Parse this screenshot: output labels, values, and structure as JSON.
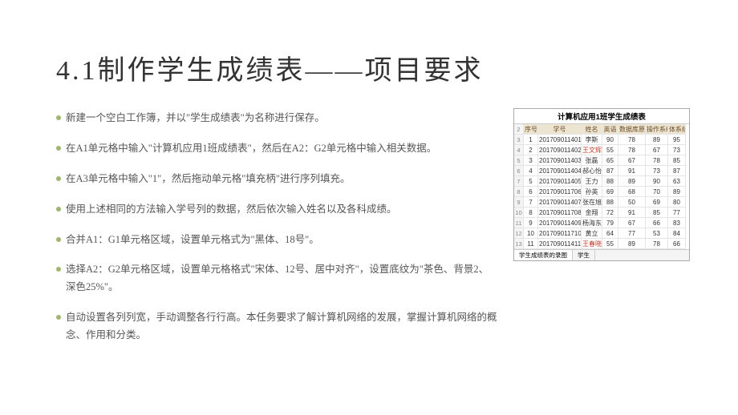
{
  "title": "4.1制作学生成绩表——项目要求",
  "bullets": [
    "新建一个空白工作簿，并以\"学生成绩表\"为名称进行保存。",
    "在A1单元格中输入\"计算机应用1班成绩表\"，然后在A2：G2单元格中输入相关数据。",
    "在A3单元格中输入\"1\"，然后拖动单元格\"填充柄\"进行序列填充。",
    "使用上述相同的方法输入学号列的数据，然后依次输入姓名以及各科成绩。",
    "合并A1：G1单元格区域，设置单元格式为\"黑体、18号\"。",
    "选择A2：G2单元格区域，设置单元格格式\"宋体、12号、居中对齐\"，设置底纹为\"茶色、背景2、深色25%\"。",
    "自动设置各列列宽，手动调整各行行高。本任务要求了解计算机网络的发展，掌握计算机网络的概念、作用和分类。"
  ],
  "preview": {
    "title": "计算机应用1班学生成绩表",
    "header": [
      "序号",
      "学号",
      "姓名",
      "英语",
      "数据库原理",
      "操作系统",
      "体系结构"
    ],
    "rows": [
      [
        "1",
        "201709011401",
        "李斯",
        "90",
        "78",
        "89",
        "95"
      ],
      [
        "2",
        "201709011402",
        "王文辉",
        "55",
        "78",
        "67",
        "73"
      ],
      [
        "3",
        "201709011403",
        "张磊",
        "65",
        "67",
        "78",
        "85"
      ],
      [
        "4",
        "201709011404",
        "郝心怡",
        "87",
        "91",
        "73",
        "87"
      ],
      [
        "5",
        "201709011405",
        "王力",
        "88",
        "89",
        "90",
        "63"
      ],
      [
        "6",
        "201709011706",
        "孙英",
        "69",
        "68",
        "70",
        "89"
      ],
      [
        "7",
        "201709011407",
        "张在旭",
        "88",
        "50",
        "69",
        "80"
      ],
      [
        "8",
        "201709011708",
        "金翔",
        "72",
        "91",
        "85",
        "77"
      ],
      [
        "9",
        "201709011409",
        "杨海东",
        "79",
        "67",
        "66",
        "83"
      ],
      [
        "10",
        "201709011710",
        "黄立",
        "64",
        "77",
        "53",
        "84"
      ],
      [
        "11",
        "201709011411",
        "王春晓",
        "55",
        "89",
        "78",
        "66"
      ]
    ],
    "row_start": 2,
    "tabs": [
      "学生成绩表的录图",
      "学生"
    ]
  }
}
